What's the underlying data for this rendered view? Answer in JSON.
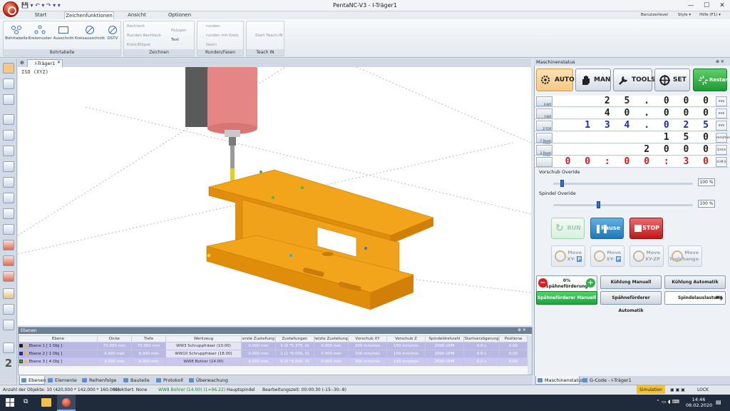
{
  "app": {
    "window_title": "PentaNC-V3 - I-Träger1",
    "quick_access": [
      "💾",
      "▾",
      "↶",
      "▾",
      "↷",
      "▾",
      "▾"
    ]
  },
  "menubar": {
    "tabs": [
      "Start",
      "Zeichenfunktionen",
      "Ansicht",
      "Optionen"
    ],
    "active_tab": "Zeichenfunktionen",
    "right_items": [
      "Benutzerlevel",
      "Style ▾",
      "Hilfe (F1) ▾"
    ]
  },
  "ribbon": {
    "groups": [
      {
        "label": "Bohrtabelle",
        "items": [
          "Bohrtabelle",
          "Kreismuster",
          "Ausschnitt",
          "Kreisausschnitt",
          "DSTV"
        ]
      },
      {
        "label": "Zeichnen",
        "items": [
          "Rechteck",
          "Runden Rechteck",
          "Kreis/Ellipse",
          "Polygon",
          "Text"
        ]
      },
      {
        "label": "Runden/Fasen",
        "items": [
          "runden",
          "runden mit Kreis",
          "fasen"
        ]
      },
      {
        "label": "Teach IN",
        "items": [
          "Start Teach-IN"
        ]
      }
    ]
  },
  "document": {
    "tab_label": "I-Träger1",
    "view_label": "ISO (XYZ)"
  },
  "layers_panel": {
    "title": "Ebenen",
    "columns": [
      "Ebene",
      "Dicke",
      "Tiefe",
      "Werkzeug",
      "erste Zustellung",
      "Zustellungen",
      "letzte Zustellung",
      "Vorschub XY",
      "Vorschub Z",
      "Spindeldrehzahl",
      "Startverzögerung",
      "Positione"
    ],
    "rows": [
      {
        "color": "#0a0a0a",
        "cells": [
          "Ebene 1 [ 1 Obj ]",
          "75.000 mm",
          "75.000 mm",
          "WW3 Schruppfräser (10.00)",
          "0.000 mm",
          "5 (0 *5.375, 0)",
          "0.000 mm",
          "300 mm/min",
          "150 mm/min",
          "2000 UPM",
          "0.0 s",
          "0.00"
        ]
      },
      {
        "color": "#1a2cd6",
        "cells": [
          "Ebene 2 [ 1 Obj ]",
          "6.000 mm",
          "9.000 mm",
          "WW10 Schruppfräser (18.00)",
          "0.000 mm",
          "1 (1 *6.000, 0)",
          "0.000 mm",
          "300 mm/min",
          "150 mm/min",
          "2000 UPM",
          "0.0 s",
          "0.00"
        ]
      },
      {
        "color": "#14c21a",
        "cells": [
          "Ebene 3 [ 4 Obj ]",
          "9.000 mm",
          "9.000 mm",
          "WW8 Bohrer (14.00)",
          "0.000 mm",
          "0 (0 *9.000, 0)",
          "0.000 mm",
          "300 mm/min",
          "150 mm/min",
          "2000 UPM",
          "0.0 s",
          "0.00"
        ]
      }
    ]
  },
  "bottom_tabs": [
    "Ebenen",
    "Elemente",
    "Reihenfolge",
    "Bauteile",
    "Protokoll",
    "Überwachung"
  ],
  "status_bar": {
    "objects": "Anzahl der Objekte: 10 (420,000 * 142,000 * 160,000)",
    "selected": "Selektiert: None",
    "tool": "WW8 Bohrer (14.00) (1=96.22)",
    "spindle": "Hauptspindel",
    "time": "Bearbeitungszeit: 00:00:30 (-15:-30:-8)",
    "simulation": "Simulation",
    "lock": "LOCK"
  },
  "machine_panel": {
    "title": "Maschinenstatus",
    "modes": [
      "AUTO",
      "MAN",
      "TOOLS",
      "SET",
      "Restart"
    ],
    "dro": [
      {
        "label": "X-WP",
        "value": "25.000",
        "display": "2 5 . 0 0 0",
        "unit": "mm",
        "color": "#222222"
      },
      {
        "label": "Y-WP",
        "value": "40.000",
        "display": "4 0 . 0 0 0",
        "unit": "mm",
        "color": "#222222"
      },
      {
        "label": "Z-TOP",
        "value": "134.025",
        "display": "1 3 4 . 0 2 5",
        "unit": "mm",
        "color": "#1a2ab8"
      },
      {
        "label": "F Reset 100%",
        "value": "150",
        "display": "1 5 0",
        "unit": "mm/min",
        "color": "#222222"
      },
      {
        "label": "S Reset 100%",
        "value": "2000",
        "display": "2 0 0 0",
        "unit": "1/min",
        "color": "#222222"
      },
      {
        "label": "",
        "value": "00:00:30",
        "display": "0 0 : 0 0 : 3 0",
        "unit": "H:M:S",
        "color": "#d01818"
      }
    ],
    "feed_override": {
      "label": "Vorschub Overide",
      "value": "100 %",
      "level": 0.05
    },
    "spindle_override": {
      "label": "Spindel Overide",
      "value": "100 %",
      "level": 0.32
    },
    "controls": [
      "RUN",
      "Pause",
      "STOP"
    ],
    "move_buttons": [
      {
        "line1": "Move",
        "line2": "XY-",
        "badge": "P"
      },
      {
        "line1": "Move",
        "line2": "XY-",
        "badge": "P"
      },
      {
        "line1": "Move",
        "line2": "XY-ZP",
        "badge": ""
      },
      {
        "line1": "Move",
        "line2": "Toolchange",
        "badge": ""
      }
    ],
    "aux": {
      "chip_feed": {
        "line1": "0%",
        "line2": "Spähneförderung"
      },
      "cool_manual": "Kühlung Manuell",
      "cool_auto": "Kühlung Automatik",
      "conveyor_manual": "Spähneförderer Manuell",
      "conveyor_auto": "Spähneförderer Automatik",
      "spindle_load": {
        "label": "Spindelauslastung",
        "value": "0%"
      }
    },
    "bottom_tabs": [
      "Maschinenstatus",
      "G-Code - I-Träger1"
    ]
  },
  "taskbar": {
    "time": "14:46",
    "date": "08.02.2020"
  },
  "colors": {
    "part": "#f2a51a",
    "spindle": "#e07c7c",
    "auto_highlight": "#f7c884",
    "run_green": "#29b34b"
  }
}
